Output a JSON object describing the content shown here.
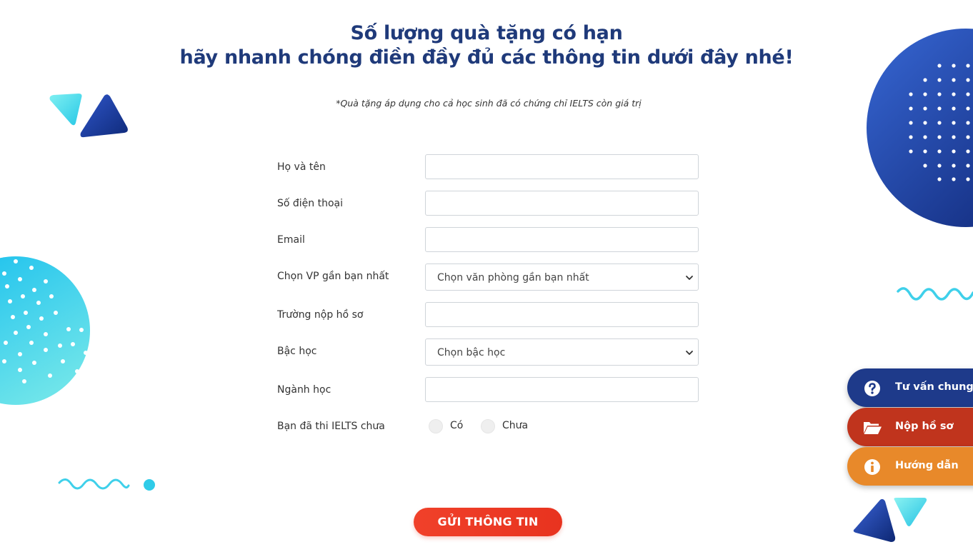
{
  "heading": {
    "line1": "Số lượng quà tặng có hạn",
    "line2": "hãy nhanh chóng điền đầy đủ các thông tin dưới đây nhé!"
  },
  "note": "*Quà tặng áp dụng cho cả học sinh đã có chứng chỉ IELTS còn giá trị",
  "form": {
    "name_label": "Họ và tên",
    "name_value": "",
    "phone_label": "Số điện thoại",
    "phone_value": "",
    "email_label": "Email",
    "email_value": "",
    "office_label": "Chọn VP gần bạn nhất",
    "office_selected": "Chọn văn phòng gần bạn nhất",
    "school_label": "Trường nộp hồ sơ",
    "school_value": "",
    "level_label": "Bậc học",
    "level_selected": "Chọn bậc học",
    "major_label": "Ngành học",
    "major_value": "",
    "ielts_label": "Bạn đã thi IELTS chưa",
    "ielts_options": [
      "Có",
      "Chưa"
    ]
  },
  "submit_label": "GỬI THÔNG TIN",
  "side_buttons": [
    {
      "label": "Tư vấn chung",
      "icon": "question-circle-icon",
      "color": "#1e3a8a"
    },
    {
      "label": "Nộp hồ sơ",
      "icon": "folder-open-icon",
      "color": "#c0341d"
    },
    {
      "label": "Hướng dẫn",
      "icon": "info-circle-icon",
      "color": "#e8892a"
    }
  ],
  "colors": {
    "heading": "#1f3a7a",
    "submit": "#e8331f",
    "deco_blue": "#1e3a8a",
    "deco_cyan": "#29c6e8"
  }
}
